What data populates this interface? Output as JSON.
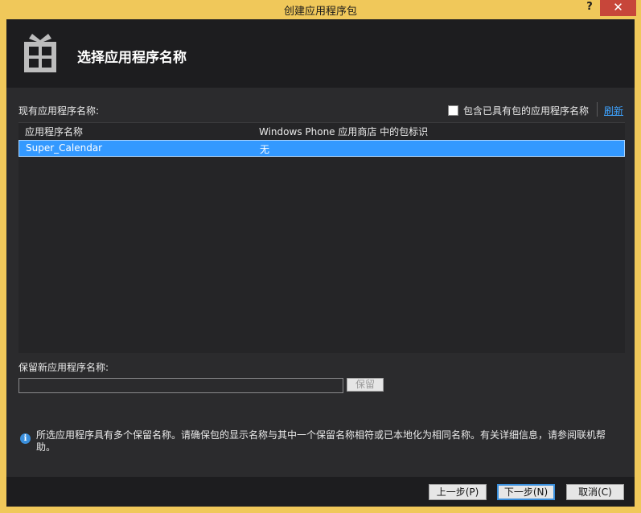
{
  "window": {
    "title": "创建应用程序包",
    "help_label": "?",
    "close_label": "✕"
  },
  "header": {
    "title": "选择应用程序名称",
    "icon": "gift-package-icon"
  },
  "existing": {
    "label": "现有应用程序名称:",
    "include_checkbox_label": "包含已具有包的应用程序名称",
    "include_checked": false,
    "refresh_label": "刷新"
  },
  "table": {
    "columns": [
      "应用程序名称",
      "Windows Phone 应用商店 中的包标识"
    ],
    "rows": [
      {
        "name": "Super_Calendar",
        "package_id": "无",
        "selected": true
      }
    ]
  },
  "reserve": {
    "label": "保留新应用程序名称:",
    "input_value": "",
    "button_label": "保留"
  },
  "info": {
    "icon_glyph": "i",
    "text": "所选应用程序具有多个保留名称。请确保包的显示名称与其中一个保留名称相符或已本地化为相同名称。有关详细信息，请参阅联机帮助。"
  },
  "footer": {
    "prev_label": "上一步(P)",
    "next_label": "下一步(N)",
    "cancel_label": "取消(C)"
  },
  "colors": {
    "titlebar": "#f0c85a",
    "selection": "#3399ff",
    "link": "#3ea3ff",
    "close": "#c7463a"
  }
}
